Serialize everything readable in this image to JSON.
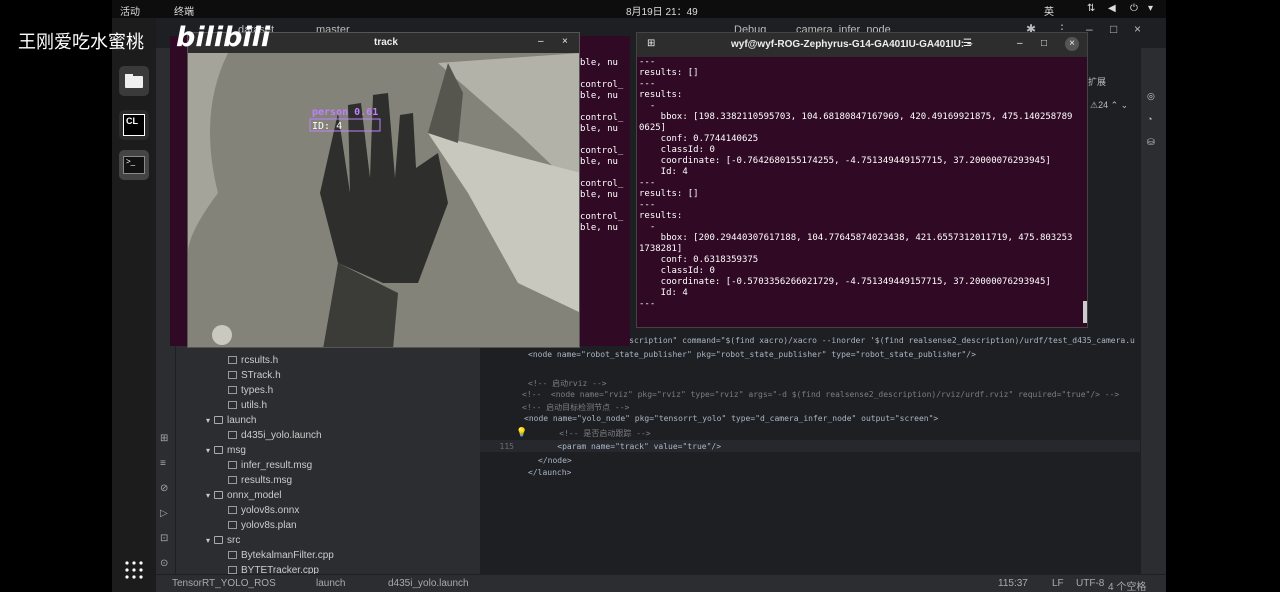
{
  "topbar": {
    "activities": "活动",
    "app": "终端",
    "datetime": "8月19日  21：49",
    "lang": "英"
  },
  "watermark": {
    "user": "王刚爱吃水蜜桃",
    "site": "bilibili"
  },
  "ide": {
    "project_tab": "dataset",
    "branch": "master",
    "run_config": "Debug",
    "run_target": "camera_infer_node",
    "tree": [
      {
        "name": "rcsults.h",
        "indent": 3,
        "type": "file"
      },
      {
        "name": "STrack.h",
        "indent": 3,
        "type": "file"
      },
      {
        "name": "types.h",
        "indent": 3,
        "type": "file"
      },
      {
        "name": "utils.h",
        "indent": 3,
        "type": "file"
      },
      {
        "name": "launch",
        "indent": 1,
        "type": "folder"
      },
      {
        "name": "d435i_yolo.launch",
        "indent": 3,
        "type": "file"
      },
      {
        "name": "msg",
        "indent": 1,
        "type": "folder"
      },
      {
        "name": "infer_result.msg",
        "indent": 3,
        "type": "file"
      },
      {
        "name": "results.msg",
        "indent": 3,
        "type": "file"
      },
      {
        "name": "onnx_model",
        "indent": 1,
        "type": "folder"
      },
      {
        "name": "yolov8s.onnx",
        "indent": 3,
        "type": "file"
      },
      {
        "name": "yolov8s.plan",
        "indent": 3,
        "type": "file"
      },
      {
        "name": "src",
        "indent": 1,
        "type": "folder"
      },
      {
        "name": "BytekalmanFilter.cpp",
        "indent": 3,
        "type": "file"
      },
      {
        "name": "BYTETracker.cpp",
        "indent": 3,
        "type": "file"
      }
    ],
    "code": [
      {
        "ln": "",
        "text": "<param name=\"robot_description\" command=\"$(find xacro)/xacro --inorder '$(find realsense2_description)/urdf/test_d435_camera.u"
      },
      {
        "ln": "",
        "text": "<node name=\"robot_state_publisher\" pkg=\"robot_state_publisher\" type=\"robot_state_publisher\"/>"
      },
      {
        "ln": "",
        "text": ""
      },
      {
        "ln": "",
        "text": "<!-- 启动rviz -->"
      },
      {
        "ln": "",
        "text": "<!--  <node name=\"rviz\" pkg=\"rviz\" type=\"rviz\" args=\"-d $(find realsense2_description)/rviz/urdf.rviz\" required=\"true\"/> -->"
      },
      {
        "ln": "",
        "text": "<!-- 启动目标检测节点 -->"
      },
      {
        "ln": "",
        "text": "<node name=\"yolo_node\" pkg=\"tensorrt_yolo\" type=\"d_camera_infer_node\" output=\"screen\">"
      },
      {
        "ln": "",
        "text": "    <!-- 是否启动跟踪 -->"
      },
      {
        "ln": "115",
        "text": "    <param name=\"track\" value=\"true\"/>"
      },
      {
        "ln": "",
        "text": "</node>"
      },
      {
        "ln": "",
        "text": "</launch>"
      }
    ],
    "status": {
      "project": "TensorRT_YOLO_ROS",
      "crumb1": "launch",
      "crumb2": "d435i_yolo.launch",
      "pos": "115:37",
      "eol": "LF",
      "enc": "UTF-8",
      "indent": "4 个空格"
    },
    "plugin_label": "双击扩展"
  },
  "bg_terminal_lines": [
    "ble, nu",
    "control_",
    "ble, nu",
    "control_",
    "ble, nu",
    "control_",
    "ble, nu",
    "control_",
    "ble, nu",
    "control_",
    "ble, nu"
  ],
  "terminal": {
    "title": "wyf@wyf-ROG-Zephyrus-G14-GA401IU-GA401IU: ~",
    "lines": [
      "---",
      "results: []",
      "---",
      "results:",
      "  -",
      "    bbox: [198.3382110595703, 104.68180847167969, 420.49169921875, 475.140258789",
      "0625]",
      "    conf: 0.7744140625",
      "    classId: 0",
      "    coordinate: [-0.7642680155174255, -4.751349449157715, 37.20000076293945]",
      "    Id: 4",
      "---",
      "results: []",
      "---",
      "results:",
      "  -",
      "    bbox: [200.29440307617188, 104.77645874023438, 421.6557312011719, 475.803253",
      "1738281]",
      "    conf: 0.6318359375",
      "    classId: 0",
      "    coordinate: [-0.5703356266021729, -4.751349449157715, 37.20000076293945]",
      "    Id: 4",
      "---"
    ]
  },
  "track": {
    "title": "track",
    "label": "person 0.61",
    "id": "ID: 4",
    "box_color": "#c080ff"
  }
}
